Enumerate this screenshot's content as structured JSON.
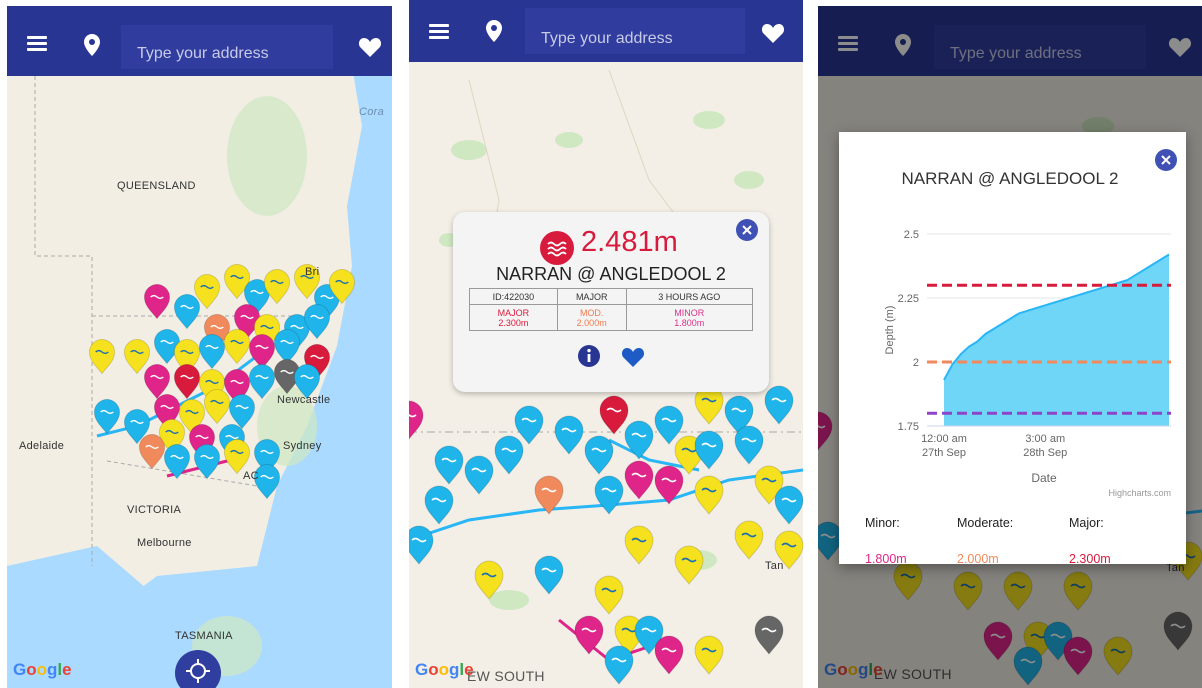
{
  "appbar": {
    "search_placeholder": "Type your address",
    "menu_icon": "hamburger-menu-icon",
    "location_icon": "map-pin-icon",
    "favorites_icon": "heart-icon",
    "color": "#283593"
  },
  "panel1": {
    "map_labels": {
      "coral": "Cora",
      "queensland": "QUEENSLAND",
      "brisbane": "Bri",
      "newcastle": "Newcastle",
      "adelaide": "Adelaide",
      "sydney": "Sydney",
      "act": "AC",
      "victoria": "VICTORIA",
      "melbourne": "Melbourne",
      "tasmania": "TASMANIA"
    },
    "google": [
      "G",
      "o",
      "o",
      "g",
      "l",
      "e"
    ],
    "locate_icon": "crosshair-locate-icon"
  },
  "panel2": {
    "popup": {
      "level": "2.481m",
      "station": "NARRAN @ ANGLEDOOL 2",
      "row1": [
        "ID:422030",
        "MAJOR",
        "3 HOURS AGO"
      ],
      "row2": [
        {
          "top": "MAJOR",
          "bottom": "2.300m",
          "color": "#d81b3c"
        },
        {
          "top": "MOD.",
          "bottom": "2.000m",
          "color": "#ef7b4f"
        },
        {
          "top": "MINOR",
          "bottom": "1.800m",
          "color": "#d6338b"
        }
      ],
      "info_icon": "info-icon",
      "favorite_icon": "heart-icon",
      "close_icon": "close-icon",
      "level_icon": "water-waves-icon"
    },
    "map_labels": {
      "nsw": "EW SOUTH",
      "tam": "Tan"
    },
    "google": [
      "G",
      "o",
      "o",
      "g",
      "l",
      "e"
    ]
  },
  "panel3": {
    "dialog": {
      "title": "NARRAN @ ANGLEDOOL 2",
      "close_icon": "close-icon",
      "credit": "Highcharts.com",
      "thresholds": [
        {
          "label": "Minor:",
          "value": "1.800m",
          "color": "#e0258a"
        },
        {
          "label": "Moderate:",
          "value": "2.000m",
          "color": "#f08a5d"
        },
        {
          "label": "Major:",
          "value": "2.300m",
          "color": "#d81b3c"
        }
      ]
    },
    "map_labels": {
      "nsw": "EW SOUTH",
      "tam": "Tan"
    },
    "google": [
      "G",
      "o",
      "o",
      "g",
      "l",
      "e"
    ]
  },
  "chart_data": {
    "type": "area",
    "title": "NARRAN @ ANGLEDOOL 2",
    "xlabel": "Date",
    "ylabel": "Depth (m)",
    "x_ticks": [
      "12:00 am 27th Sep",
      "3:00 am 28th Sep"
    ],
    "y_ticks": [
      1.75,
      2,
      2.25,
      2.5
    ],
    "ylim": [
      1.75,
      2.5
    ],
    "series": [
      {
        "x_hours": [
          0,
          1,
          2,
          3,
          4,
          5,
          6,
          7,
          8,
          9,
          10,
          11,
          12,
          13,
          14,
          15,
          16,
          17,
          18,
          19,
          20,
          21,
          22,
          23,
          24,
          25,
          26,
          27
        ],
        "values": [
          1.93,
          1.99,
          2.03,
          2.06,
          2.08,
          2.11,
          2.13,
          2.15,
          2.17,
          2.19,
          2.2,
          2.21,
          2.22,
          2.23,
          2.24,
          2.25,
          2.26,
          2.27,
          2.28,
          2.29,
          2.3,
          2.31,
          2.32,
          2.34,
          2.36,
          2.38,
          2.4,
          2.42
        ]
      }
    ],
    "thresholds": [
      {
        "value": 2.3,
        "color": "#d81b3c",
        "style": "dashed"
      },
      {
        "value": 2.0,
        "color": "#f08a5d",
        "style": "dashed"
      },
      {
        "value": 1.8,
        "color": "#8e44c9",
        "style": "dashed"
      }
    ],
    "area_color": "#5fd1f7",
    "grid": true
  }
}
